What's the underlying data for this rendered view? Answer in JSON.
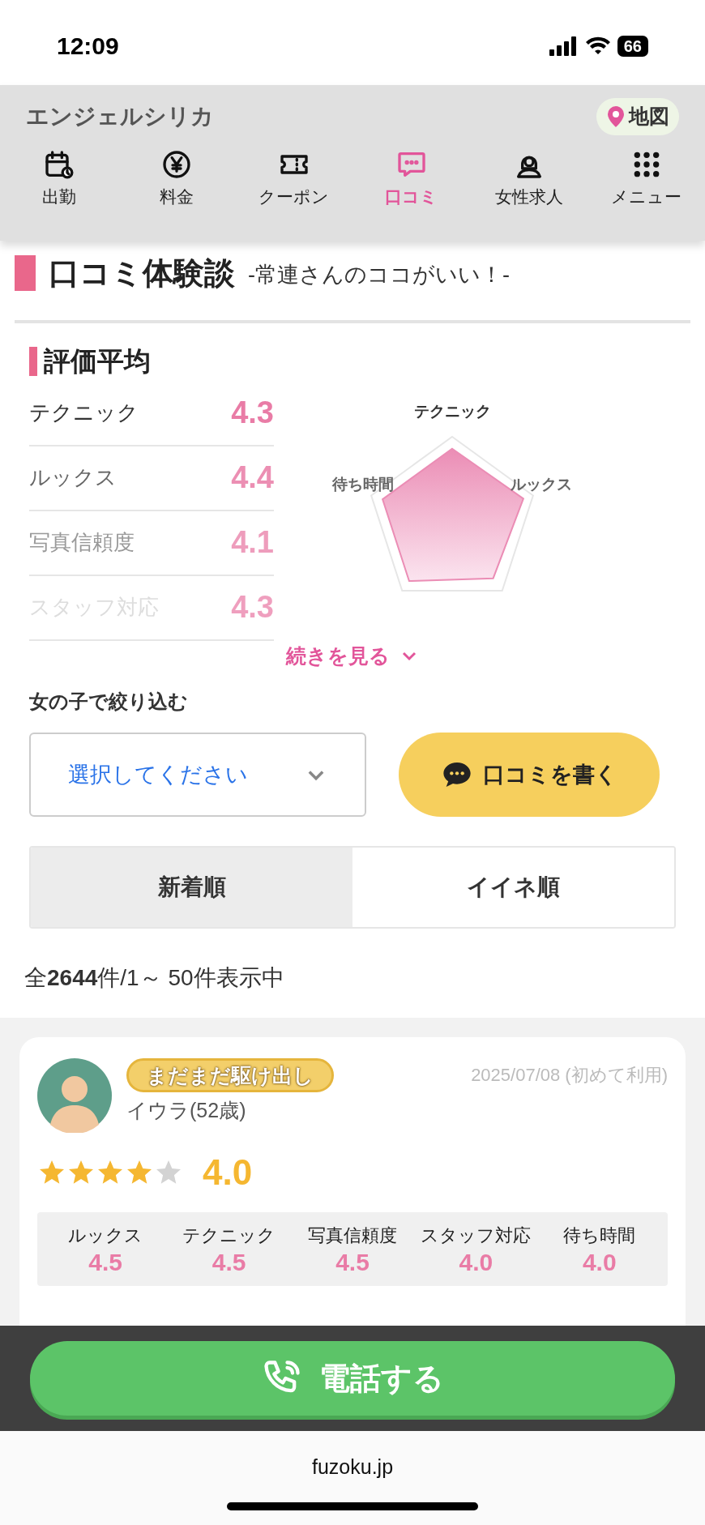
{
  "status_bar": {
    "time": "12:09",
    "battery": "66"
  },
  "header": {
    "shop_name": "エンジェルシリカ",
    "map_button": "地図"
  },
  "nav": [
    {
      "kind": "calendar",
      "label": "出勤",
      "selected": false
    },
    {
      "kind": "yen",
      "label": "料金",
      "selected": false
    },
    {
      "kind": "ticket",
      "label": "クーポン",
      "selected": false
    },
    {
      "kind": "chat",
      "label": "口コミ",
      "selected": true
    },
    {
      "kind": "woman",
      "label": "女性求人",
      "selected": false
    },
    {
      "kind": "grid",
      "label": "メニュー",
      "selected": false
    }
  ],
  "page_title": {
    "title": "口コミ体験談",
    "subtitle": "-常連さんのココがいい！-"
  },
  "average": {
    "heading": "評価平均",
    "items": [
      {
        "label": "テクニック",
        "value": "4.3"
      },
      {
        "label": "ルックス",
        "value": "4.4"
      },
      {
        "label": "写真信頼度",
        "value": "4.1"
      },
      {
        "label": "スタッフ対応",
        "value": "4.3"
      }
    ],
    "radar_labels": [
      "テクニック",
      "ルックス",
      "待ち時間"
    ],
    "more_link": "続きを見る"
  },
  "filter": {
    "label": "女の子で絞り込む",
    "placeholder": "選択してください",
    "write_button": "口コミを書く"
  },
  "sort_tabs": [
    {
      "label": "新着順",
      "selected": true
    },
    {
      "label": "イイネ順",
      "selected": false
    }
  ],
  "count": "全**2644**件/1～ 50件表示中",
  "review": {
    "badge": "まだまだ駆け出し",
    "date": "2025/07/08 (初めて利用)",
    "reviewer": "イウラ(52歳)",
    "stars": 4,
    "score": "4.0",
    "scores": [
      {
        "label": "ルックス",
        "value": "4.5"
      },
      {
        "label": "テクニック",
        "value": "4.5"
      },
      {
        "label": "写真信頼度",
        "value": "4.5"
      },
      {
        "label": "スタッフ対応",
        "value": "4.0"
      },
      {
        "label": "待ち時間",
        "value": "4.0"
      }
    ]
  },
  "call_button": "電話する",
  "browser": {
    "url": "fuzoku.jp"
  }
}
